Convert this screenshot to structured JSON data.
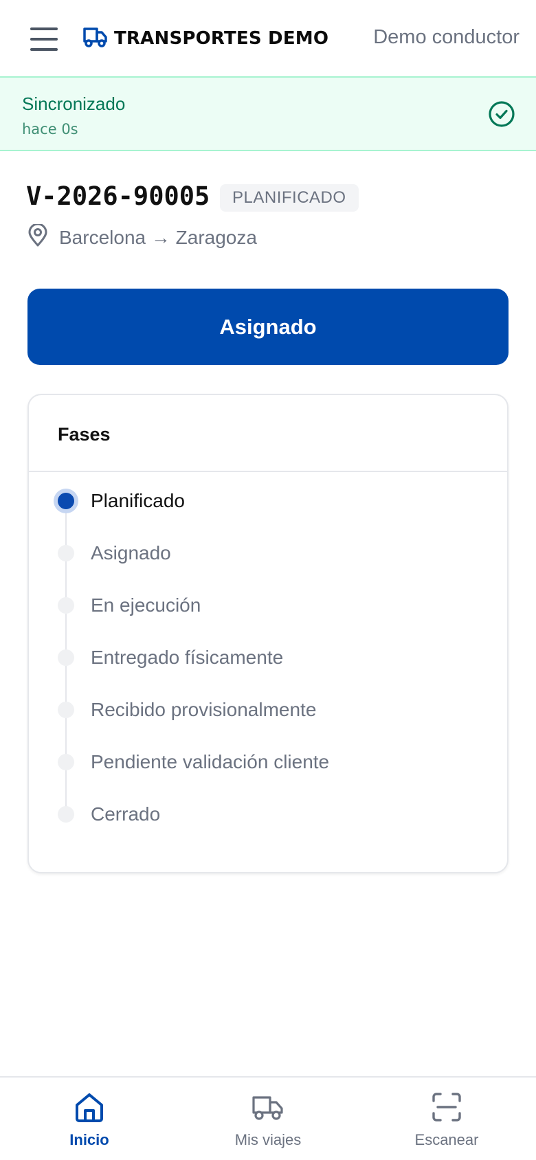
{
  "header": {
    "brand_title": "TRANSPORTES DEMO",
    "user_name": "Demo conductor",
    "brand_color": "#004aad"
  },
  "sync": {
    "title": "Sincronizado",
    "subtitle": "hace 0s",
    "color": "#047857"
  },
  "trip": {
    "id": "V-2026-90005",
    "status": "PLANIFICADO",
    "route": "Barcelona → Zaragoza"
  },
  "primary_action": {
    "label": "Asignado"
  },
  "phases": {
    "title": "Fases",
    "current_index": 0,
    "items": [
      {
        "label": "Planificado"
      },
      {
        "label": "Asignado"
      },
      {
        "label": "En ejecución"
      },
      {
        "label": "Entregado físicamente"
      },
      {
        "label": "Recibido provisionalmente"
      },
      {
        "label": "Pendiente validación cliente"
      },
      {
        "label": "Cerrado"
      }
    ]
  },
  "bottom_nav": {
    "active": "Inicio",
    "items": [
      {
        "label": "Inicio",
        "icon": "home-icon"
      },
      {
        "label": "Mis viajes",
        "icon": "truck-icon"
      },
      {
        "label": "Escanear",
        "icon": "scan-icon"
      }
    ]
  }
}
